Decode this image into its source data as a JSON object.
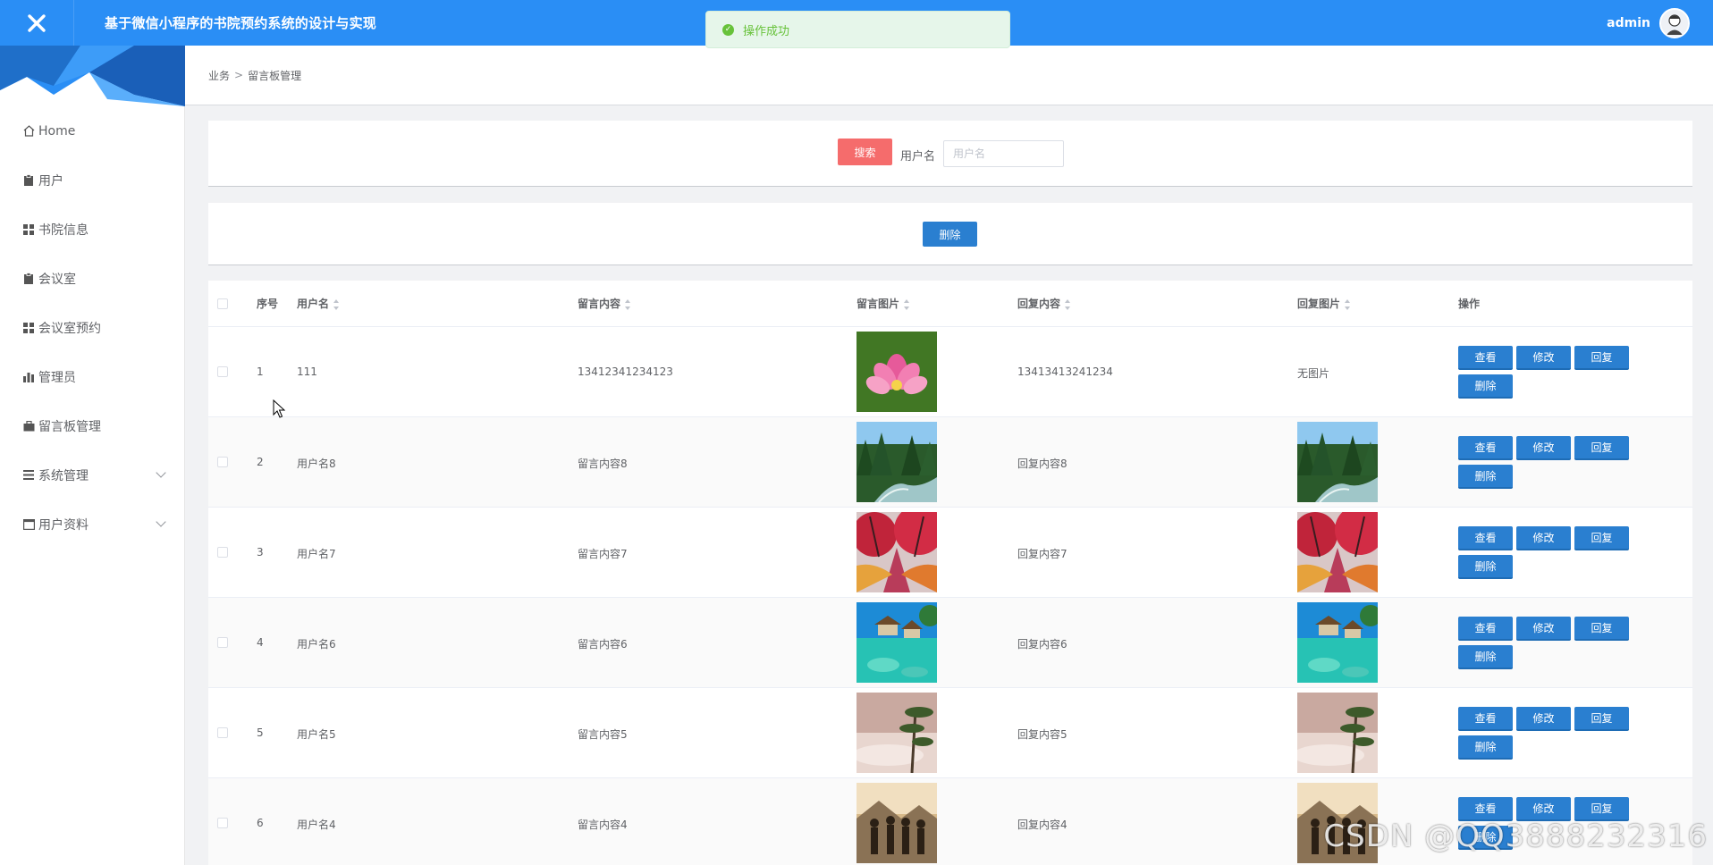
{
  "header": {
    "app_title": "基于微信小程序的书院预约系统的设计与实现",
    "username": "admin"
  },
  "toast": {
    "message": "操作成功"
  },
  "sidebar": {
    "items": [
      {
        "label": "Home",
        "icon": "home-icon"
      },
      {
        "label": "用户",
        "icon": "clipboard-icon"
      },
      {
        "label": "书院信息",
        "icon": "grid-icon"
      },
      {
        "label": "会议室",
        "icon": "clipboard-icon"
      },
      {
        "label": "会议室预约",
        "icon": "grid-icon"
      },
      {
        "label": "管理员",
        "icon": "bar-chart-icon"
      },
      {
        "label": "留言板管理",
        "icon": "briefcase-icon"
      },
      {
        "label": "系统管理",
        "icon": "list-icon",
        "expandable": true
      },
      {
        "label": "用户资料",
        "icon": "window-icon",
        "expandable": true
      }
    ]
  },
  "breadcrumb": {
    "level1": "业务",
    "separator": ">",
    "level2": "留言板管理"
  },
  "search": {
    "button_label": "搜索",
    "field_label": "用户名",
    "placeholder": "用户名"
  },
  "actions": {
    "delete_label": "删除"
  },
  "table": {
    "columns": {
      "index": "序号",
      "username": "用户名",
      "content": "留言内容",
      "image": "留言图片",
      "reply": "回复内容",
      "reply_image": "回复图片",
      "operations": "操作"
    },
    "op_labels": {
      "view": "查看",
      "edit": "修改",
      "reply": "回复",
      "delete": "删除"
    },
    "rows": [
      {
        "index": "1",
        "username": "111",
        "content": "13412341234123",
        "image": "lotus",
        "reply": "13413413241234",
        "reply_image": "none",
        "reply_image_text": "无图片"
      },
      {
        "index": "2",
        "username": "用户名8",
        "content": "留言内容8",
        "image": "forest-river",
        "reply": "回复内容8",
        "reply_image": "forest-river"
      },
      {
        "index": "3",
        "username": "用户名7",
        "content": "留言内容7",
        "image": "red-trees",
        "reply": "回复内容7",
        "reply_image": "red-trees"
      },
      {
        "index": "4",
        "username": "用户名6",
        "content": "留言内容6",
        "image": "tropical-sea",
        "reply": "回复内容6",
        "reply_image": "tropical-sea"
      },
      {
        "index": "5",
        "username": "用户名5",
        "content": "留言内容5",
        "image": "misty-pine",
        "reply": "回复内容5",
        "reply_image": "misty-pine"
      },
      {
        "index": "6",
        "username": "用户名4",
        "content": "留言内容4",
        "image": "people-sunset",
        "reply": "回复内容4",
        "reply_image": "people-sunset"
      }
    ]
  },
  "watermark": "CSDN @QQ3888232316",
  "colors": {
    "header_bg": "#2a8ef5",
    "search_button": "#f56c6c",
    "action_button": "#2a7fd0",
    "toast_bg": "#e6f6ea",
    "toast_text": "#67c23a"
  }
}
